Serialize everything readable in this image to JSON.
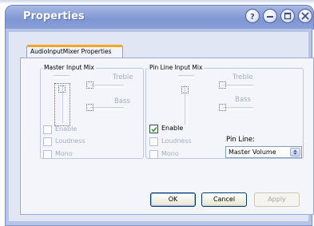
{
  "window": {
    "title": "Properties",
    "tab_label": "AudioInputMixer Properties"
  },
  "master_group": {
    "label": "Master Input Mix",
    "treble_label": "Treble",
    "bass_label": "Bass",
    "enable_label": "Enable",
    "loudness_label": "Loudness",
    "mono_label": "Mono",
    "enable_checked": false,
    "loudness_checked": false,
    "mono_checked": false
  },
  "pin_group": {
    "label": "Pin Line Input Mix",
    "treble_label": "Treble",
    "bass_label": "Bass",
    "enable_label": "Enable",
    "loudness_label": "Loudness",
    "mono_label": "Mono",
    "enable_checked": true,
    "loudness_checked": false,
    "mono_checked": false,
    "pin_line_label": "Pin Line:",
    "pin_line_value": "Master Volume"
  },
  "buttons": {
    "ok": "OK",
    "cancel": "Cancel",
    "apply": "Apply"
  },
  "icons": {
    "help": "help-icon",
    "minimize": "minimize-icon",
    "maximize": "maximize-icon",
    "close": "close-icon"
  },
  "colors": {
    "title_bar": "#8ea3d9",
    "tab_accent": "#f5a623",
    "check_mark": "#21a121"
  }
}
